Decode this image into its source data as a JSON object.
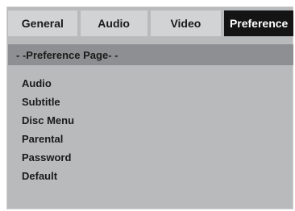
{
  "tabs": [
    {
      "label": "General"
    },
    {
      "label": "Audio"
    },
    {
      "label": "Video"
    },
    {
      "label": "Preference",
      "selected": true
    }
  ],
  "page_header": {
    "prefix": "- -",
    "title": "Preference Page",
    "suffix": "- -"
  },
  "menu": {
    "items": [
      {
        "label": "Audio"
      },
      {
        "label": "Subtitle"
      },
      {
        "label": "Disc Menu"
      },
      {
        "label": "Parental"
      },
      {
        "label": "Password"
      },
      {
        "label": "Default"
      }
    ]
  },
  "colors": {
    "panel_bg": "#b9babc",
    "tab_bg": "#d2d3d5",
    "tab_selected_bg": "#141414",
    "header_bg": "#8d8f92"
  }
}
